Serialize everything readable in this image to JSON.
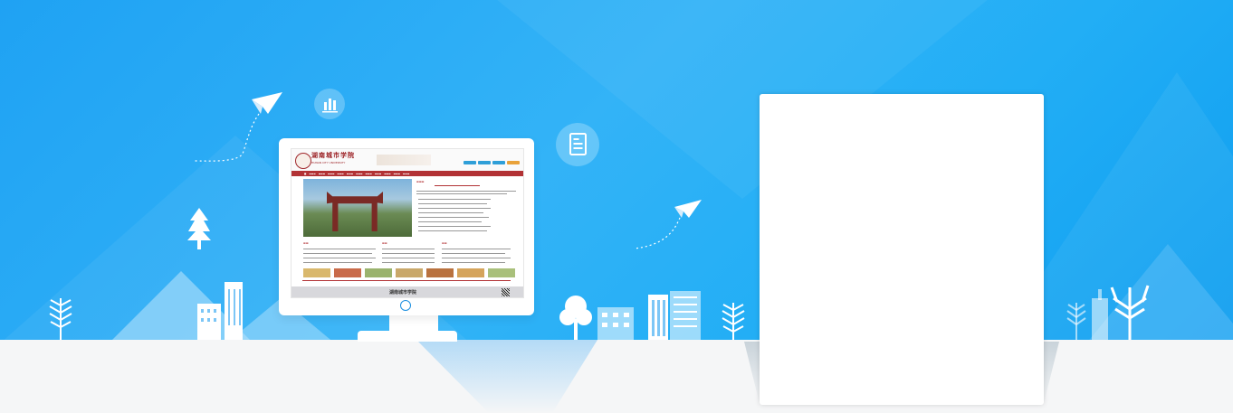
{
  "hero": {
    "mock_site": {
      "name": "湖南城市学院",
      "subtitle": "HUNAN CITY UNIVERSITY",
      "footer_name": "湖南城市学院"
    }
  },
  "colors": {
    "sky": "#1fa2f3",
    "site_red": "#b23235",
    "ground": "#f5f6f7"
  },
  "icons": [
    "paper-plane-icon",
    "bar-chart-icon",
    "document-icon",
    "tree-icon",
    "building-icon"
  ]
}
